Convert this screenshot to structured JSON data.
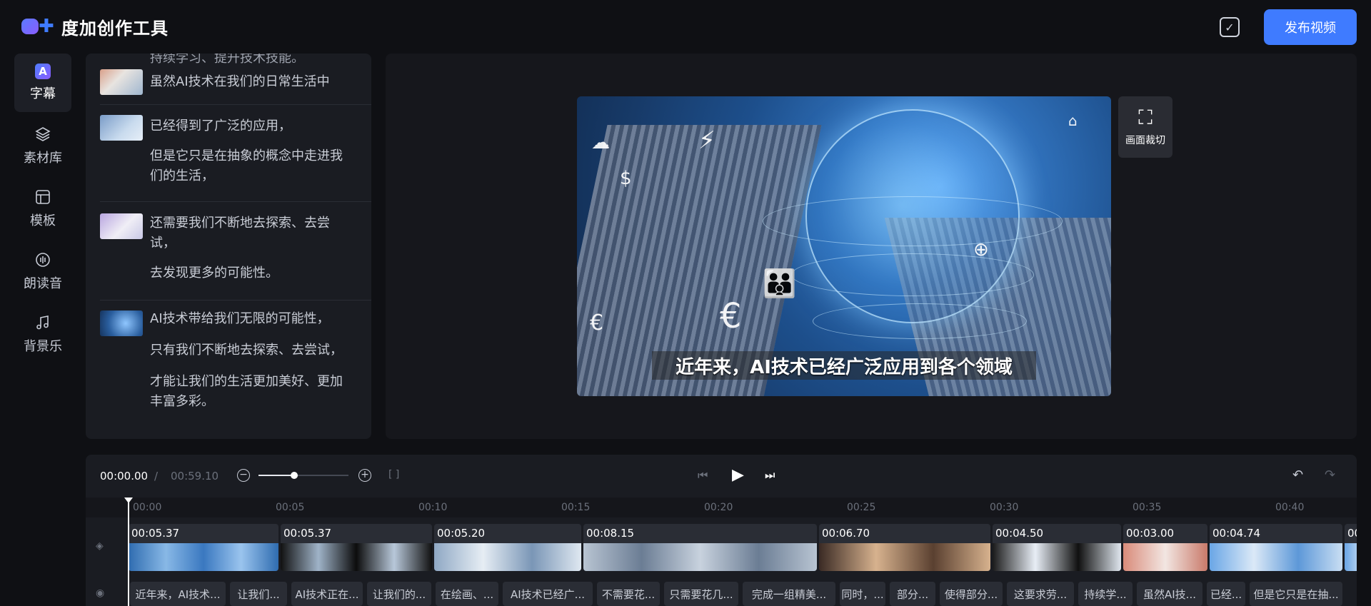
{
  "app": {
    "logo_text": "度加创作工具",
    "publish_label": "发布视频"
  },
  "nav": [
    {
      "label": "字幕",
      "icon": "subtitle-icon",
      "active": true
    },
    {
      "label": "素材库",
      "icon": "layers-icon",
      "active": false
    },
    {
      "label": "模板",
      "icon": "template-icon",
      "active": false
    },
    {
      "label": "朗读音",
      "icon": "voice-icon",
      "active": false
    },
    {
      "label": "背景乐",
      "icon": "music-icon",
      "active": false
    }
  ],
  "subtitles": {
    "top_cut": "持续学习、提升技术技能。",
    "groups": [
      {
        "lines": [
          "虽然AI技术在我们的日常生活中"
        ]
      },
      {
        "lines": [
          "已经得到了广泛的应用，",
          "但是它只是在抽象的概念中走进我们的生活，"
        ]
      },
      {
        "lines": [
          "还需要我们不断地去探索、去尝试，",
          "去发现更多的可能性。"
        ]
      },
      {
        "lines": [
          "AI技术带给我们无限的可能性，",
          "只有我们不断地去探索、去尝试，",
          "才能让我们的生活更加美好、更加丰富多彩。"
        ]
      }
    ]
  },
  "preview": {
    "caption": "近年来，AI技术已经广泛应用到各个领域",
    "crop_label": "画面裁切"
  },
  "timeline": {
    "current_time": "00:00.00",
    "separator": "/",
    "total_time": "00:59.10",
    "zoom_level": 0.4,
    "ruler_ticks": [
      "00:00",
      "00:05",
      "00:10",
      "00:15",
      "00:20",
      "00:25",
      "00:30",
      "00:35",
      "00:40"
    ],
    "video_clips": [
      {
        "duration": "00:05.37"
      },
      {
        "duration": "00:05.37"
      },
      {
        "duration": "00:05.20"
      },
      {
        "duration": "00:08.15"
      },
      {
        "duration": "00:06.70"
      },
      {
        "duration": "00:04.50"
      },
      {
        "duration": "00:03.00"
      },
      {
        "duration": "00:04.74"
      },
      {
        "duration": "00"
      }
    ],
    "subtitle_chips": [
      "近年来，AI技术...",
      "让我们...",
      "AI技术正在...",
      "让我们的...",
      "在绘画、...",
      "AI技术已经广...",
      "不需要花...",
      "只需要花几...",
      "完成一组精美...",
      "同时，...",
      "部分...",
      "使得部分...",
      "这要求劳...",
      "持续学...",
      "虽然AI技...",
      "已经...",
      "但是它只是在抽..."
    ]
  }
}
